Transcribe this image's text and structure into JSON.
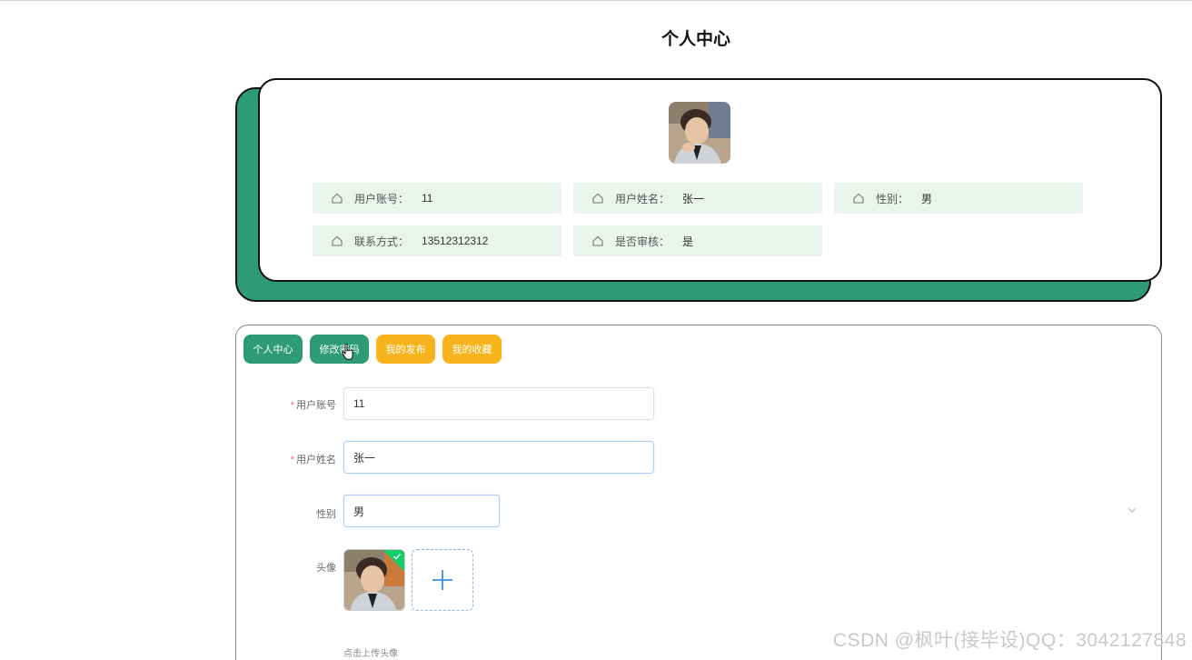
{
  "page": {
    "title": "个人中心"
  },
  "profile": {
    "fields": [
      {
        "label": "用户账号：",
        "value": "11"
      },
      {
        "label": "用户姓名：",
        "value": "张一"
      },
      {
        "label": "性别：",
        "value": "男"
      },
      {
        "label": "联系方式：",
        "value": "13512312312"
      },
      {
        "label": "是否审核：",
        "value": "是"
      }
    ],
    "field_icon": "home-icon"
  },
  "tabs": [
    {
      "label": "个人中心",
      "color": "#2e9a78"
    },
    {
      "label": "修改密码",
      "color": "#2e9a78"
    },
    {
      "label": "我的发布",
      "color": "#f6b31c"
    },
    {
      "label": "我的收藏",
      "color": "#f6b31c"
    }
  ],
  "form": {
    "account": {
      "label": "用户账号",
      "value": "11",
      "required": "*"
    },
    "name": {
      "label": "用户姓名",
      "value": "张一",
      "required": "*"
    },
    "gender": {
      "label": "性别",
      "value": "男"
    },
    "avatar": {
      "label": "头像",
      "hint": "点击上传头像"
    }
  },
  "watermark": "CSDN @枫叶(接毕设)QQ：3042127848",
  "colors": {
    "primary": "#2e9a78",
    "accent": "#f6b31c",
    "info_bg": "#eaf3ec",
    "success": "#13ce66"
  }
}
